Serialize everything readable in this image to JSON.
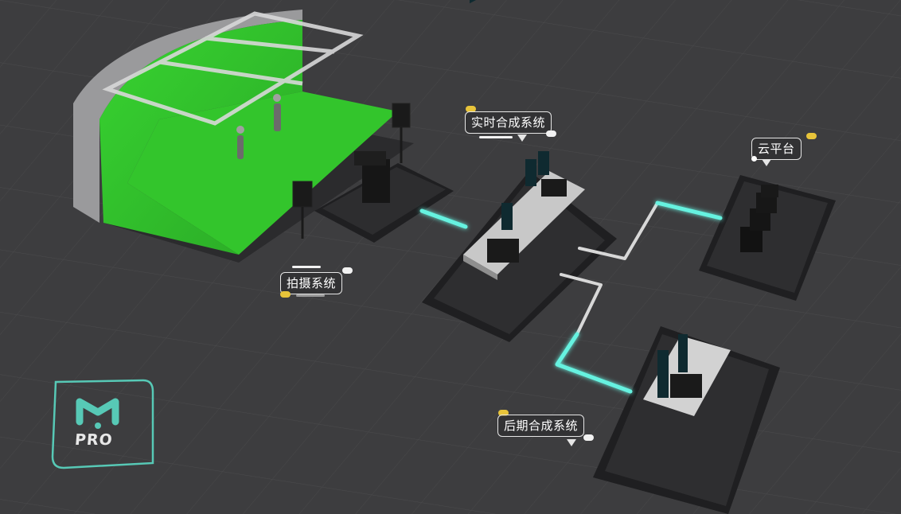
{
  "labels": {
    "shooting": "拍摄系统",
    "realtime": "实时合成系统",
    "cloud": "云平台",
    "post": "后期合成系统"
  },
  "logo": {
    "text": "PRO",
    "monogram": "M"
  },
  "colors": {
    "background": "#3d3d3f",
    "green_screen": "#31c22a",
    "platform": "#2c2c2e",
    "glow": "#66f2e0",
    "logo_accent": "#57c9b6"
  }
}
